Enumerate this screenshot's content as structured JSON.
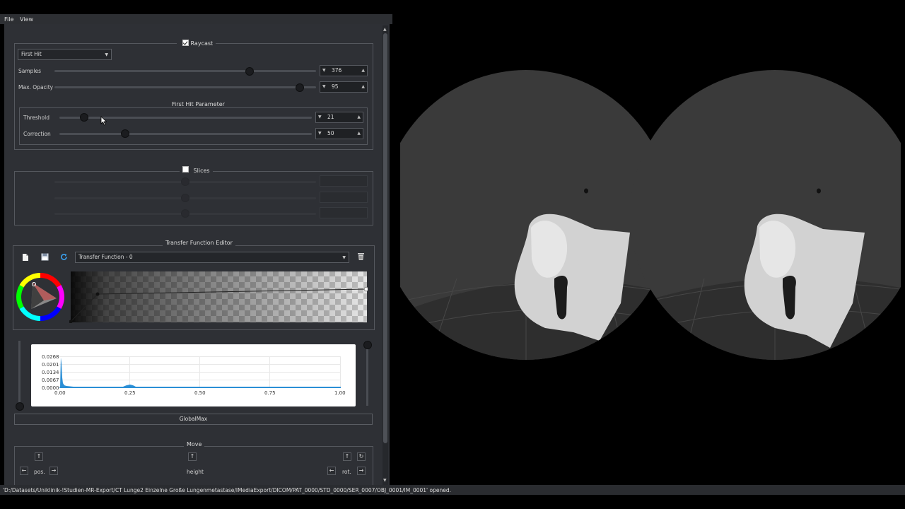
{
  "menu": {
    "file": "File",
    "view": "View"
  },
  "raycast": {
    "title": "Raycast",
    "checked": true,
    "mode": "First Hit",
    "samples": {
      "label": "Samples",
      "value": "376",
      "level": 0.74
    },
    "max_opacity": {
      "label": "Max. Opacity",
      "value": "95",
      "level": 0.93
    }
  },
  "first_hit": {
    "title": "First Hit Parameter",
    "threshold": {
      "label": "Threshold",
      "value": "21",
      "level": 0.1
    },
    "correction": {
      "label": "Correction",
      "value": "50",
      "level": 0.26
    }
  },
  "slices": {
    "title": "Slices",
    "checked": false
  },
  "transfer_function": {
    "title": "Transfer Function Editor",
    "selected": "Transfer Function - 0",
    "icons": [
      "new-file-icon",
      "save-icon",
      "refresh-icon",
      "trash-icon"
    ]
  },
  "histogram": {
    "y_ticks": [
      "0.0268",
      "0.0201",
      "0.0134",
      "0.0067",
      "0.0000"
    ],
    "x_ticks": [
      "0.00",
      "0.25",
      "0.50",
      "0.75",
      "1.00"
    ]
  },
  "global_max_button": "GlobalMax",
  "move": {
    "title": "Move",
    "pos_label": "pos.",
    "height_label": "height",
    "rot_label": "rot.",
    "arrow_up": "↑",
    "arrow_left": "←",
    "arrow_right": "→",
    "rotate": "↻"
  },
  "status": "'D:/Datasets/Uniklinik-!Studien-MR-Export/CT Lunge2 Einzelne Große Lungenmetastase/IMediaExport/DICOM/PAT_0000/STD_0000/SER_0007/OBJ_0001/IM_0001' opened.",
  "colors": {
    "panel": "#2e3035",
    "accent": "#2b8fd6",
    "background": "#000000"
  }
}
